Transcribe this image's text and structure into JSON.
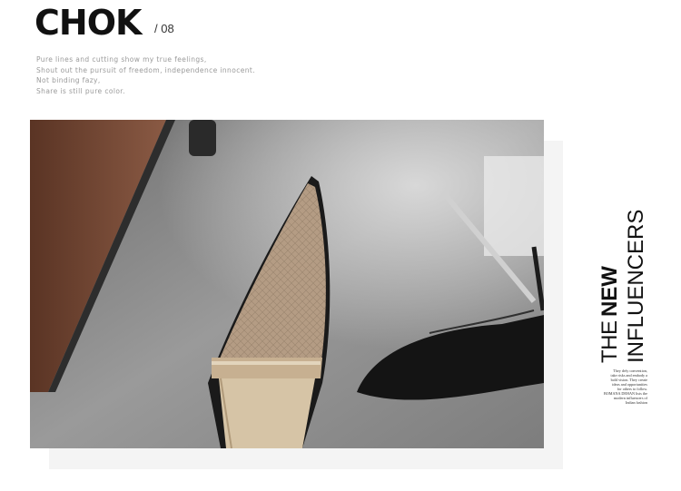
{
  "header": {
    "brand": "CHOK",
    "page_number": "/ 08"
  },
  "tagline": [
    "Pure lines and cutting show my true feelings,",
    "Shout out the pursuit of freedom, independence innocent.",
    "Not binding fazy,",
    "Share is still pure color."
  ],
  "side_title": {
    "line1": "THE",
    "line2": "NEW",
    "line3": "INFLUENCERS"
  },
  "side_note": [
    "They defy convention,",
    "take risks and embody a",
    "bold vision. They create",
    "ideas and opportunities",
    "for others to follow.",
    "BOMANA DEHAN lists the",
    "modern influencers of",
    "Indian fashion"
  ]
}
